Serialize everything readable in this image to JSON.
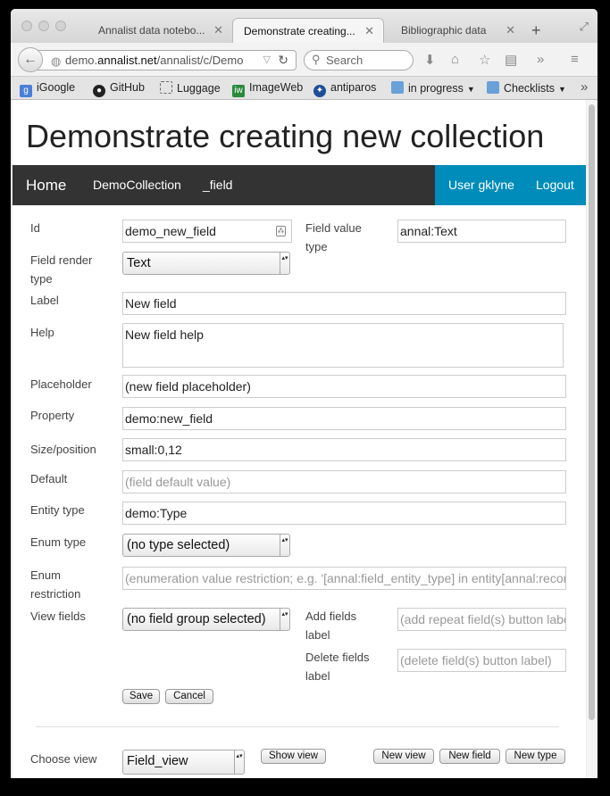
{
  "browser": {
    "tabs": [
      {
        "title": "Annalist data notebo..."
      },
      {
        "title": "Demonstrate creating..."
      },
      {
        "title": "Bibliographic data"
      }
    ],
    "url_prefix": "demo.",
    "url_host": "annalist.net",
    "url_path": "/annalist/c/Demo",
    "search_placeholder": "Search",
    "bookmarks": [
      {
        "label": "iGoogle",
        "icon": "google-icon",
        "color": "#4a7fd8"
      },
      {
        "label": "GitHub",
        "icon": "github-icon",
        "color": "#222222"
      },
      {
        "label": "Luggage",
        "icon": "dashed-box-icon",
        "color": "#666666"
      },
      {
        "label": "ImageWeb",
        "icon": "imageweb-icon",
        "color": "#2b8a3e"
      },
      {
        "label": "antiparos",
        "icon": "antiparos-icon",
        "color": "#1f4e99"
      },
      {
        "label": "in progress",
        "icon": "folder-icon",
        "color": "#6aa0d8"
      },
      {
        "label": "Checklists",
        "icon": "folder-icon",
        "color": "#6aa0d8"
      }
    ]
  },
  "page": {
    "title": "Demonstrate creating new collection",
    "nav": {
      "home": "Home",
      "collection": "DemoCollection",
      "type": "_field",
      "user": "User gklyne",
      "logout": "Logout"
    },
    "accent_color": "#008cba",
    "navbar_color": "#333333"
  },
  "form": {
    "id_label": "Id",
    "id_value": "demo_new_field",
    "value_type_label_1": "Field value",
    "value_type_label_2": "type",
    "value_type_value": "annal:Text",
    "render_type_label_1": "Field render",
    "render_type_label_2": "type",
    "render_type_value": "Text",
    "label_label": "Label",
    "label_value": "New field",
    "help_label": "Help",
    "help_value": "New field help",
    "placeholder_label": "Placeholder",
    "placeholder_value": "(new field placeholder)",
    "property_label": "Property",
    "property_value": "demo:new_field",
    "size_label": "Size/position",
    "size_value": "small:0,12",
    "default_label": "Default",
    "default_placeholder": "(field default value)",
    "entity_type_label": "Entity type",
    "entity_type_value": "demo:Type",
    "enum_type_label": "Enum type",
    "enum_type_value": "(no type selected)",
    "enum_restriction_label_1": "Enum",
    "enum_restriction_label_2": "restriction",
    "enum_restriction_placeholder": "(enumeration value restriction; e.g. '[annal:field_entity_type] in entity[annal:recor",
    "view_fields_label": "View fields",
    "view_fields_value": "(no field group selected)",
    "add_fields_label_1": "Add fields",
    "add_fields_label_2": "label",
    "add_fields_placeholder": "(add repeat field(s) button label)",
    "delete_fields_label_1": "Delete fields",
    "delete_fields_label_2": "label",
    "delete_fields_placeholder": "(delete field(s) button label)",
    "save": "Save",
    "cancel": "Cancel"
  },
  "footer": {
    "choose_view_label": "Choose view",
    "view_value": "Field_view",
    "show_view": "Show view",
    "new_view": "New view",
    "new_field": "New field",
    "new_type": "New type"
  }
}
